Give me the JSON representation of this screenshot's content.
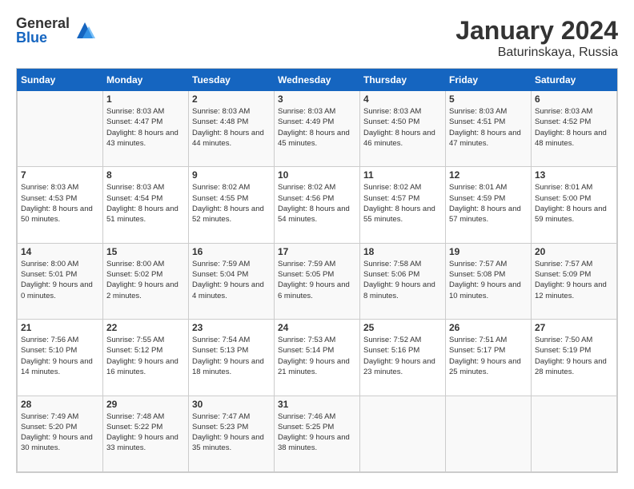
{
  "logo": {
    "general": "General",
    "blue": "Blue"
  },
  "header": {
    "month": "January 2024",
    "location": "Baturinskaya, Russia"
  },
  "days_of_week": [
    "Sunday",
    "Monday",
    "Tuesday",
    "Wednesday",
    "Thursday",
    "Friday",
    "Saturday"
  ],
  "weeks": [
    [
      {
        "num": "",
        "sunrise": "",
        "sunset": "",
        "daylight": "",
        "empty": true
      },
      {
        "num": "1",
        "sunrise": "Sunrise: 8:03 AM",
        "sunset": "Sunset: 4:47 PM",
        "daylight": "Daylight: 8 hours and 43 minutes."
      },
      {
        "num": "2",
        "sunrise": "Sunrise: 8:03 AM",
        "sunset": "Sunset: 4:48 PM",
        "daylight": "Daylight: 8 hours and 44 minutes."
      },
      {
        "num": "3",
        "sunrise": "Sunrise: 8:03 AM",
        "sunset": "Sunset: 4:49 PM",
        "daylight": "Daylight: 8 hours and 45 minutes."
      },
      {
        "num": "4",
        "sunrise": "Sunrise: 8:03 AM",
        "sunset": "Sunset: 4:50 PM",
        "daylight": "Daylight: 8 hours and 46 minutes."
      },
      {
        "num": "5",
        "sunrise": "Sunrise: 8:03 AM",
        "sunset": "Sunset: 4:51 PM",
        "daylight": "Daylight: 8 hours and 47 minutes."
      },
      {
        "num": "6",
        "sunrise": "Sunrise: 8:03 AM",
        "sunset": "Sunset: 4:52 PM",
        "daylight": "Daylight: 8 hours and 48 minutes."
      }
    ],
    [
      {
        "num": "7",
        "sunrise": "Sunrise: 8:03 AM",
        "sunset": "Sunset: 4:53 PM",
        "daylight": "Daylight: 8 hours and 50 minutes."
      },
      {
        "num": "8",
        "sunrise": "Sunrise: 8:03 AM",
        "sunset": "Sunset: 4:54 PM",
        "daylight": "Daylight: 8 hours and 51 minutes."
      },
      {
        "num": "9",
        "sunrise": "Sunrise: 8:02 AM",
        "sunset": "Sunset: 4:55 PM",
        "daylight": "Daylight: 8 hours and 52 minutes."
      },
      {
        "num": "10",
        "sunrise": "Sunrise: 8:02 AM",
        "sunset": "Sunset: 4:56 PM",
        "daylight": "Daylight: 8 hours and 54 minutes."
      },
      {
        "num": "11",
        "sunrise": "Sunrise: 8:02 AM",
        "sunset": "Sunset: 4:57 PM",
        "daylight": "Daylight: 8 hours and 55 minutes."
      },
      {
        "num": "12",
        "sunrise": "Sunrise: 8:01 AM",
        "sunset": "Sunset: 4:59 PM",
        "daylight": "Daylight: 8 hours and 57 minutes."
      },
      {
        "num": "13",
        "sunrise": "Sunrise: 8:01 AM",
        "sunset": "Sunset: 5:00 PM",
        "daylight": "Daylight: 8 hours and 59 minutes."
      }
    ],
    [
      {
        "num": "14",
        "sunrise": "Sunrise: 8:00 AM",
        "sunset": "Sunset: 5:01 PM",
        "daylight": "Daylight: 9 hours and 0 minutes."
      },
      {
        "num": "15",
        "sunrise": "Sunrise: 8:00 AM",
        "sunset": "Sunset: 5:02 PM",
        "daylight": "Daylight: 9 hours and 2 minutes."
      },
      {
        "num": "16",
        "sunrise": "Sunrise: 7:59 AM",
        "sunset": "Sunset: 5:04 PM",
        "daylight": "Daylight: 9 hours and 4 minutes."
      },
      {
        "num": "17",
        "sunrise": "Sunrise: 7:59 AM",
        "sunset": "Sunset: 5:05 PM",
        "daylight": "Daylight: 9 hours and 6 minutes."
      },
      {
        "num": "18",
        "sunrise": "Sunrise: 7:58 AM",
        "sunset": "Sunset: 5:06 PM",
        "daylight": "Daylight: 9 hours and 8 minutes."
      },
      {
        "num": "19",
        "sunrise": "Sunrise: 7:57 AM",
        "sunset": "Sunset: 5:08 PM",
        "daylight": "Daylight: 9 hours and 10 minutes."
      },
      {
        "num": "20",
        "sunrise": "Sunrise: 7:57 AM",
        "sunset": "Sunset: 5:09 PM",
        "daylight": "Daylight: 9 hours and 12 minutes."
      }
    ],
    [
      {
        "num": "21",
        "sunrise": "Sunrise: 7:56 AM",
        "sunset": "Sunset: 5:10 PM",
        "daylight": "Daylight: 9 hours and 14 minutes."
      },
      {
        "num": "22",
        "sunrise": "Sunrise: 7:55 AM",
        "sunset": "Sunset: 5:12 PM",
        "daylight": "Daylight: 9 hours and 16 minutes."
      },
      {
        "num": "23",
        "sunrise": "Sunrise: 7:54 AM",
        "sunset": "Sunset: 5:13 PM",
        "daylight": "Daylight: 9 hours and 18 minutes."
      },
      {
        "num": "24",
        "sunrise": "Sunrise: 7:53 AM",
        "sunset": "Sunset: 5:14 PM",
        "daylight": "Daylight: 9 hours and 21 minutes."
      },
      {
        "num": "25",
        "sunrise": "Sunrise: 7:52 AM",
        "sunset": "Sunset: 5:16 PM",
        "daylight": "Daylight: 9 hours and 23 minutes."
      },
      {
        "num": "26",
        "sunrise": "Sunrise: 7:51 AM",
        "sunset": "Sunset: 5:17 PM",
        "daylight": "Daylight: 9 hours and 25 minutes."
      },
      {
        "num": "27",
        "sunrise": "Sunrise: 7:50 AM",
        "sunset": "Sunset: 5:19 PM",
        "daylight": "Daylight: 9 hours and 28 minutes."
      }
    ],
    [
      {
        "num": "28",
        "sunrise": "Sunrise: 7:49 AM",
        "sunset": "Sunset: 5:20 PM",
        "daylight": "Daylight: 9 hours and 30 minutes."
      },
      {
        "num": "29",
        "sunrise": "Sunrise: 7:48 AM",
        "sunset": "Sunset: 5:22 PM",
        "daylight": "Daylight: 9 hours and 33 minutes."
      },
      {
        "num": "30",
        "sunrise": "Sunrise: 7:47 AM",
        "sunset": "Sunset: 5:23 PM",
        "daylight": "Daylight: 9 hours and 35 minutes."
      },
      {
        "num": "31",
        "sunrise": "Sunrise: 7:46 AM",
        "sunset": "Sunset: 5:25 PM",
        "daylight": "Daylight: 9 hours and 38 minutes."
      },
      {
        "num": "",
        "sunrise": "",
        "sunset": "",
        "daylight": "",
        "empty": true
      },
      {
        "num": "",
        "sunrise": "",
        "sunset": "",
        "daylight": "",
        "empty": true
      },
      {
        "num": "",
        "sunrise": "",
        "sunset": "",
        "daylight": "",
        "empty": true
      }
    ]
  ]
}
